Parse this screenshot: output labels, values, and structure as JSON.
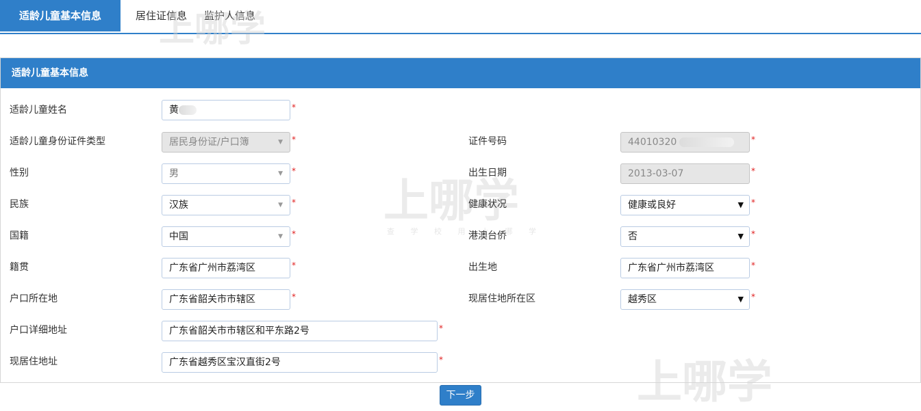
{
  "tabs": [
    {
      "label": "适龄儿童基本信息",
      "active": true
    },
    {
      "label": "居住证信息",
      "active": false
    },
    {
      "label": "监护人信息",
      "active": false
    }
  ],
  "panel": {
    "title": "适龄儿童基本信息"
  },
  "form": {
    "name": {
      "label": "适龄儿童姓名",
      "value": "黄"
    },
    "id_type": {
      "label": "适龄儿童身份证件类型",
      "value": "居民身份证/户口簿"
    },
    "id_number": {
      "label": "证件号码",
      "value": "44010320"
    },
    "gender": {
      "label": "性别",
      "value": "男"
    },
    "birth_date": {
      "label": "出生日期",
      "value": "2013-03-07"
    },
    "ethnicity": {
      "label": "民族",
      "value": "汉族"
    },
    "health": {
      "label": "健康状况",
      "value": "健康或良好"
    },
    "nationality": {
      "label": "国籍",
      "value": "中国"
    },
    "overseas": {
      "label": "港澳台侨",
      "value": "否"
    },
    "native_place": {
      "label": "籍贯",
      "value": "广东省广州市荔湾区"
    },
    "birth_place": {
      "label": "出生地",
      "value": "广东省广州市荔湾区"
    },
    "hukou_location": {
      "label": "户口所在地",
      "value": "广东省韶关市市辖区"
    },
    "current_district": {
      "label": "现居住地所在区",
      "value": "越秀区"
    },
    "hukou_address": {
      "label": "户口详细地址",
      "value": "广东省韶关市市辖区和平东路2号"
    },
    "current_address": {
      "label": "现居住地址",
      "value": "广东省越秀区宝汉直街2号"
    }
  },
  "required_mark": "*",
  "next_button": "下一步",
  "watermark": {
    "text": "上哪学",
    "sub": "查 学 校 用 上 哪 学"
  },
  "colors": {
    "accent": "#2f7fc9",
    "required": "#e02020"
  }
}
